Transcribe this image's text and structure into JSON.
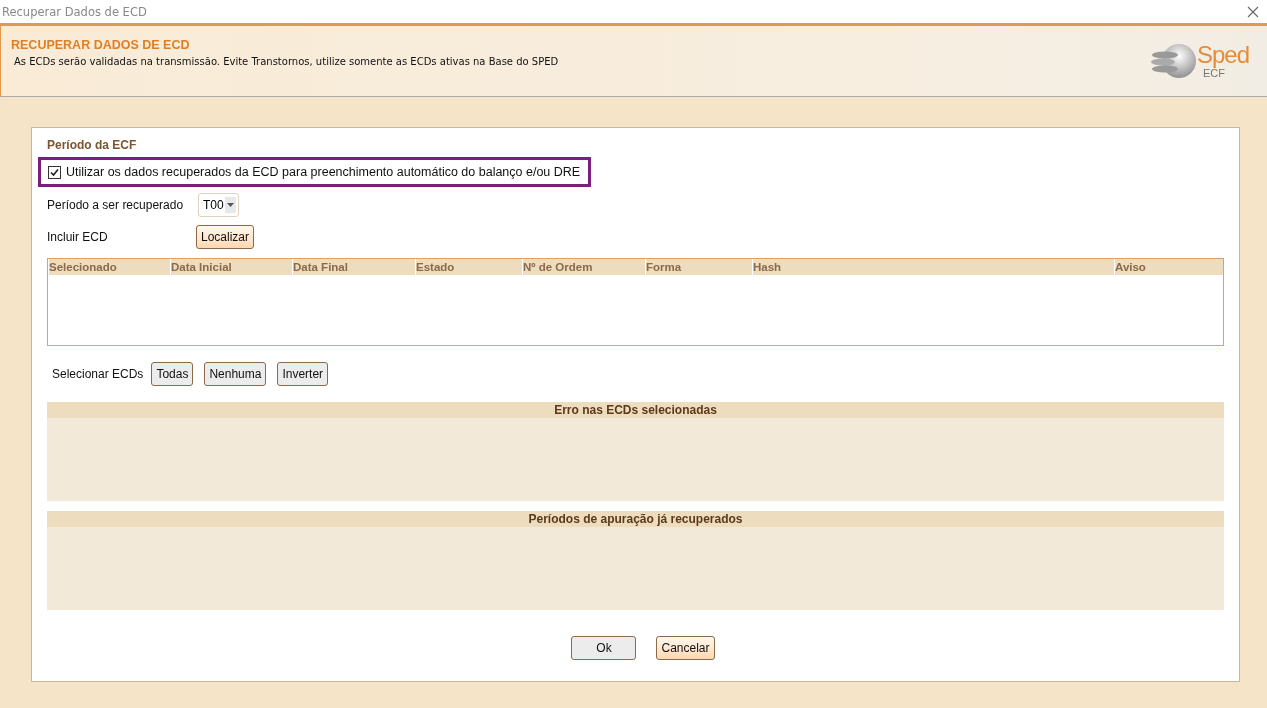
{
  "window": {
    "title": "Recuperar Dados de ECD"
  },
  "header": {
    "title": "RECUPERAR DADOS DE ECD",
    "subtitle": "As ECDs serão validadas na transmissão. Evite Transtornos, utilize somente as ECDs ativas na Base do SPED",
    "logo_text": "Sped",
    "logo_subtext": "ECF"
  },
  "section_title": "Período da ECF",
  "auto_fill": {
    "label": "Utilizar os dados recuperados da ECD para preenchimento automático do balanço e/ou DRE",
    "checked": true
  },
  "period": {
    "label": "Período a ser recuperado",
    "value": "T00"
  },
  "include": {
    "label": "Incluir ECD",
    "button": {
      "label": "Localizar",
      "kind": "accent"
    }
  },
  "table": {
    "columns": [
      "Selecionado",
      "Data Inicial",
      "Data Final",
      "Estado",
      "Nº de Ordem",
      "Forma",
      "Hash",
      "Aviso"
    ]
  },
  "select": {
    "label": "Selecionar ECDs",
    "buttons": [
      "Todas",
      "Nenhuma",
      "Inverter"
    ]
  },
  "panels": [
    {
      "title": "Erro nas ECDs selecionadas"
    },
    {
      "title": "Períodos de apuração já recuperados"
    }
  ],
  "buttons": [
    {
      "label": "Ok",
      "kind": "plain"
    },
    {
      "label": "Cancelar",
      "kind": "accent"
    }
  ]
}
